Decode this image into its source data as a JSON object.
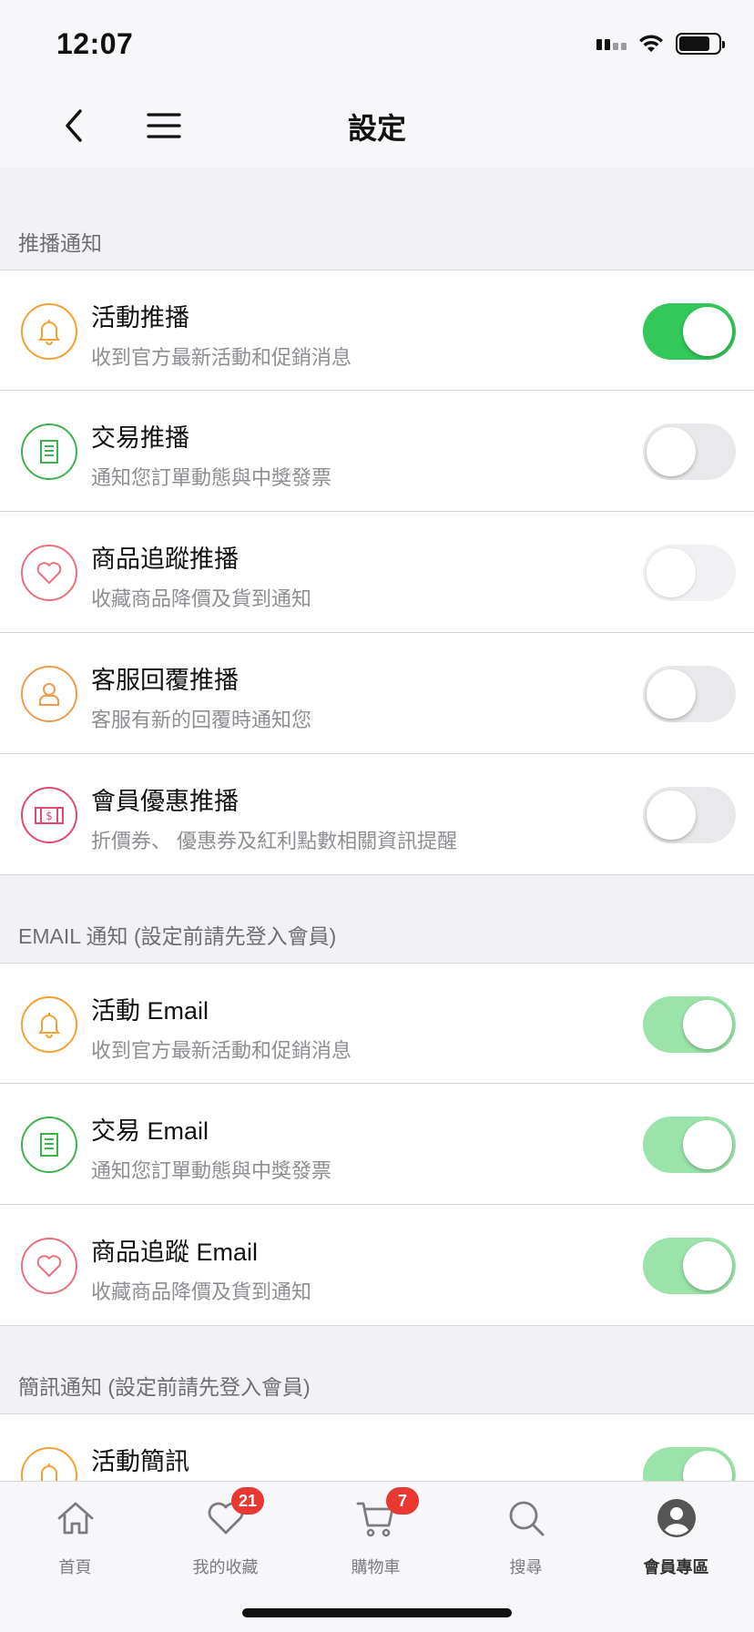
{
  "status_bar": {
    "time": "12:07"
  },
  "nav": {
    "title": "設定"
  },
  "sections": [
    {
      "header": "推播通知",
      "rows": [
        {
          "title": "活動推播",
          "subtitle": "收到官方最新活動和促銷消息",
          "icon": "bell-icon",
          "toggle": "on"
        },
        {
          "title": "交易推播",
          "subtitle": "通知您訂單動態與中獎發票",
          "icon": "receipt-icon",
          "toggle": "off"
        },
        {
          "title": "商品追蹤推播",
          "subtitle": "收藏商品降價及貨到通知",
          "icon": "heart-icon",
          "toggle": "off-disabled"
        },
        {
          "title": "客服回覆推播",
          "subtitle": "客服有新的回覆時通知您",
          "icon": "customer-service-icon",
          "toggle": "off"
        },
        {
          "title": "會員優惠推播",
          "subtitle": "折價券、 優惠券及紅利點數相關資訊提醒",
          "icon": "coupon-icon",
          "toggle": "off"
        }
      ]
    },
    {
      "header": "EMAIL 通知 (設定前請先登入會員)",
      "rows": [
        {
          "title": "活動 Email",
          "subtitle": "收到官方最新活動和促銷消息",
          "icon": "bell-icon",
          "toggle": "on-disabled"
        },
        {
          "title": "交易 Email",
          "subtitle": "通知您訂單動態與中獎發票",
          "icon": "receipt-icon",
          "toggle": "on-disabled"
        },
        {
          "title": "商品追蹤 Email",
          "subtitle": "收藏商品降價及貨到通知",
          "icon": "heart-icon",
          "toggle": "on-disabled"
        }
      ]
    },
    {
      "header": "簡訊通知 (設定前請先登入會員)",
      "rows": [
        {
          "title": "活動簡訊",
          "icon": "bell-icon",
          "toggle": "on-disabled"
        }
      ]
    }
  ],
  "tab_bar": {
    "tabs": [
      {
        "label": "首頁",
        "icon": "home-icon"
      },
      {
        "label": "我的收藏",
        "icon": "heart-icon",
        "badge": "21"
      },
      {
        "label": "購物車",
        "icon": "cart-icon",
        "badge": "7"
      },
      {
        "label": "搜尋",
        "icon": "search-icon"
      },
      {
        "label": "會員專區",
        "icon": "member-icon",
        "active": true
      }
    ]
  },
  "colors": {
    "toggle_on": "#34c759",
    "toggle_on_disabled": "#9ae3a9",
    "bell_orange": "#f5a033",
    "receipt_green": "#3cb44b",
    "heart_pink": "#ee6f7c",
    "service_orange": "#f29a4a",
    "coupon_red": "#e04a6d",
    "badge_red": "#e8382f"
  }
}
